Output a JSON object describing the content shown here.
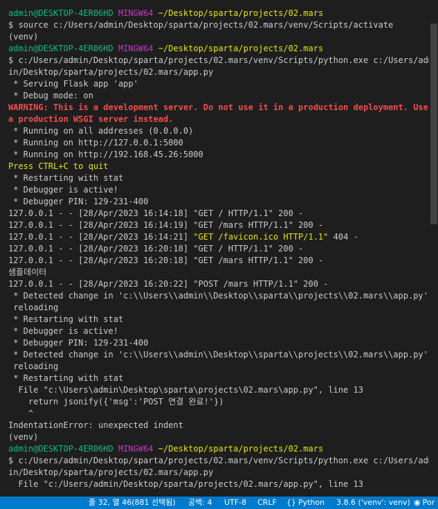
{
  "terminal": {
    "prompt_user": "admin@DESKTOP-4ER06HD",
    "prompt_sys": "MINGW64",
    "prompt_path": "~/Desktop/sparta/projects/02.mars",
    "cmd_source": "$ source c:/Users/admin/Desktop/sparta/projects/02.mars/venv/Scripts/activate",
    "venv": "(venv)",
    "cmd_run_1a": "$ c:/Users/admin/Desktop/sparta/projects/02.mars/venv/Scripts/python.exe c:/Users/adm",
    "cmd_run_1b": "in/Desktop/sparta/projects/02.mars/app.py",
    "serving": " * Serving Flask app 'app'",
    "debug_mode": " * Debug mode: on",
    "warning_1": "WARNING: This is a development server. Do not use it in a production deployment. Use",
    "warning_2": "a production WSGI server instead.",
    "running_all": " * Running on all addresses (0.0.0.0)",
    "running_local": " * Running on http://127.0.0.1:5000",
    "running_lan": " * Running on http://192.168.45.26:5000",
    "press_quit": "Press CTRL+C to quit",
    "restarting": " * Restarting with stat",
    "debugger_active": " * Debugger is active!",
    "debugger_pin": " * Debugger PIN: 129-231-400",
    "log_1": "127.0.0.1 - - [28/Apr/2023 16:14:18] \"GET / HTTP/1.1\" 200 -",
    "log_2": "127.0.0.1 - - [28/Apr/2023 16:14:19] \"GET /mars HTTP/1.1\" 200 -",
    "log_3_prefix": "127.0.0.1 - - [28/Apr/2023 16:14:21] ",
    "log_3_request": "\"GET /favicon.ico HTTP/1.1\"",
    "log_3_suffix": " 404 -",
    "log_4": "127.0.0.1 - - [28/Apr/2023 16:20:18] \"GET / HTTP/1.1\" 200 -",
    "log_5": "127.0.0.1 - - [28/Apr/2023 16:20:18] \"GET /mars HTTP/1.1\" 200 -",
    "sample_data": "샘플데이터",
    "log_6": "127.0.0.1 - - [28/Apr/2023 16:20:22] \"POST /mars HTTP/1.1\" 200 -",
    "detected": " * Detected change in 'c:\\\\Users\\\\admin\\\\Desktop\\\\sparta\\\\projects\\\\02.mars\\\\app.py',",
    "reloading": " reloading",
    "file_line": "  File \"c:\\Users\\admin\\Desktop\\sparta\\projects\\02.mars\\app.py\", line 13",
    "code_line": "    return jsonify({'msg':'POST 연결 완료!'})",
    "caret": "    ^",
    "error": "IndentationError: unexpected indent",
    "cmd_run_2a": "$ c:/Users/admin/Desktop/sparta/projects/02.mars/venv/Scripts/python.exe c:/Users/adm",
    "cmd_run_2b": "in/Desktop/sparta/projects/02.mars/app.py",
    "file_line_2": "  File \"c:/Users/admin/Desktop/sparta/projects/02.mars/app.py\", line 13"
  },
  "statusbar": {
    "cursor": "줄 32, 열 46(881 선택됨)",
    "spaces": "공백: 4",
    "encoding": "UTF-8",
    "eol": "CRLF",
    "language_icon": "braces-icon",
    "language": "Python",
    "interpreter": "3.8.6 ('venv': venv)",
    "port_icon": "broadcast-icon",
    "port": "Por"
  },
  "colors": {
    "background": "#1e1e1e",
    "text": "#cccccc",
    "prompt_user": "#0dbc79",
    "prompt_sys": "#bc3fbc",
    "prompt_path": "#e5e510",
    "warning": "#f14c4c",
    "statusbar": "#007acc"
  }
}
